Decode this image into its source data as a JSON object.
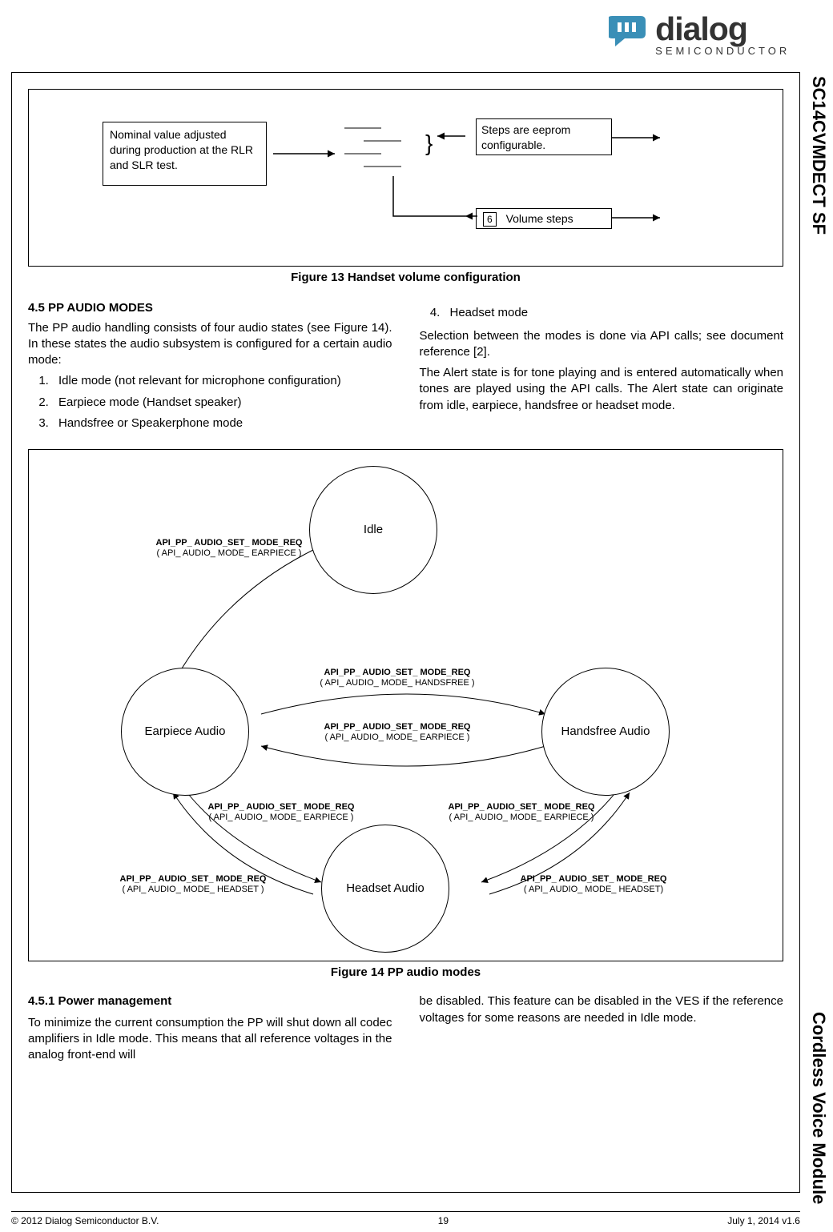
{
  "logo": {
    "name": "dialog",
    "sub": "SEMICONDUCTOR"
  },
  "side": {
    "top": "SC14CVMDECT SF",
    "bottom": "Cordless Voice Module"
  },
  "fig13": {
    "left_box": "Nominal value adjusted during production at the RLR and SLR test.",
    "right_top": "Steps are eeprom configurable.",
    "right_bot_num": "6",
    "right_bot_txt": "Volume steps",
    "caption": "Figure 13  Handset volume configuration"
  },
  "section45": {
    "heading": "4.5  PP AUDIO MODES",
    "p1": "The PP audio handling consists of four audio states (see Figure 14). In these states the audio subsystem is configured for a certain audio mode:",
    "li1": "Idle mode (not relevant for microphone configuration)",
    "li2": "Earpiece mode (Handset speaker)",
    "li3": "Handsfree or Speakerphone mode",
    "li4": "Headset mode",
    "p2": "Selection between the modes is done via API calls; see document reference [2].",
    "p3": "The Alert state is for tone playing and is entered automatically when tones are played using the API calls. The Alert state can originate from idle, earpiece, handsfree or headset mode."
  },
  "fig14": {
    "states": {
      "idle": "Idle",
      "earpiece": "Earpiece Audio",
      "handsfree": "Handsfree Audio",
      "headset": "Headset Audio"
    },
    "api": "API_PP_ AUDIO_SET_ MODE_REQ",
    "params": {
      "earpiece": "( API_ AUDIO_ MODE_ EARPIECE )",
      "handsfree": "( API_ AUDIO_ MODE_  HANDSFREE  )",
      "headset_l": "( API_ AUDIO_ MODE_ HEADSET )",
      "headset_r": "( API_ AUDIO_ MODE_ HEADSET)"
    },
    "caption": "Figure 14  PP audio modes"
  },
  "section451": {
    "heading": "4.5.1 Power management",
    "p1": "To minimize the current consumption the PP will shut down all codec amplifiers in Idle mode. This means that all reference voltages in the analog front-end will",
    "p2": "be disabled. This feature can be disabled in the VES if the reference voltages for some reasons are needed in Idle mode."
  },
  "footer": {
    "left": "© 2012 Dialog Semiconductor B.V.",
    "center": "19",
    "right": "July 1, 2014 v1.6"
  }
}
